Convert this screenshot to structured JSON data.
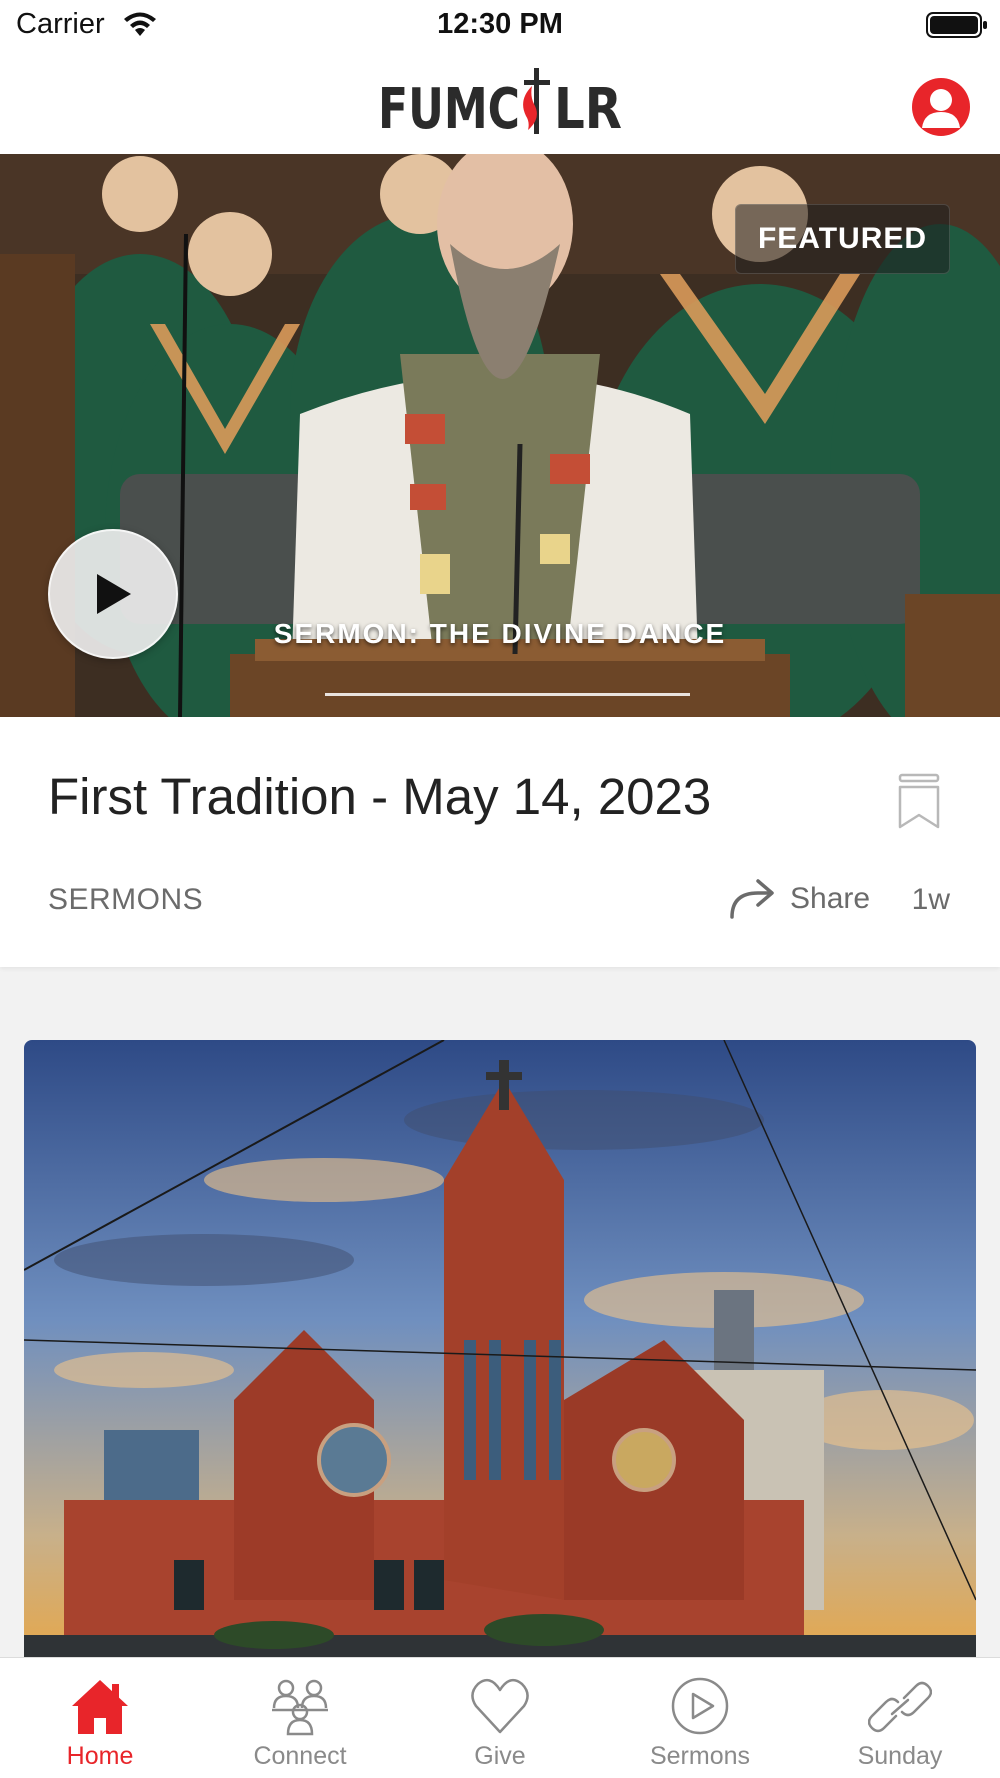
{
  "status_bar": {
    "carrier": "Carrier",
    "time": "12:30 PM"
  },
  "header": {
    "logo_text": "FUMC LR",
    "accent_color": "#e8252a"
  },
  "featured": {
    "badge": "FEATURED",
    "video_caption": "SERMON: THE DIVINE DANCE",
    "title": "First Tradition - May 14, 2023",
    "category": "SERMONS",
    "share_label": "Share",
    "time_ago": "1w"
  },
  "tabs": [
    {
      "label": "Home",
      "icon": "home-icon",
      "active": true
    },
    {
      "label": "Connect",
      "icon": "people-icon",
      "active": false
    },
    {
      "label": "Give",
      "icon": "heart-icon",
      "active": false
    },
    {
      "label": "Sermons",
      "icon": "play-circle-icon",
      "active": false
    },
    {
      "label": "Sunday",
      "icon": "link-icon",
      "active": false
    }
  ],
  "colors": {
    "accent": "#e8252a",
    "muted_text": "#8a8a8a",
    "robe_green": "#1f5a40"
  }
}
